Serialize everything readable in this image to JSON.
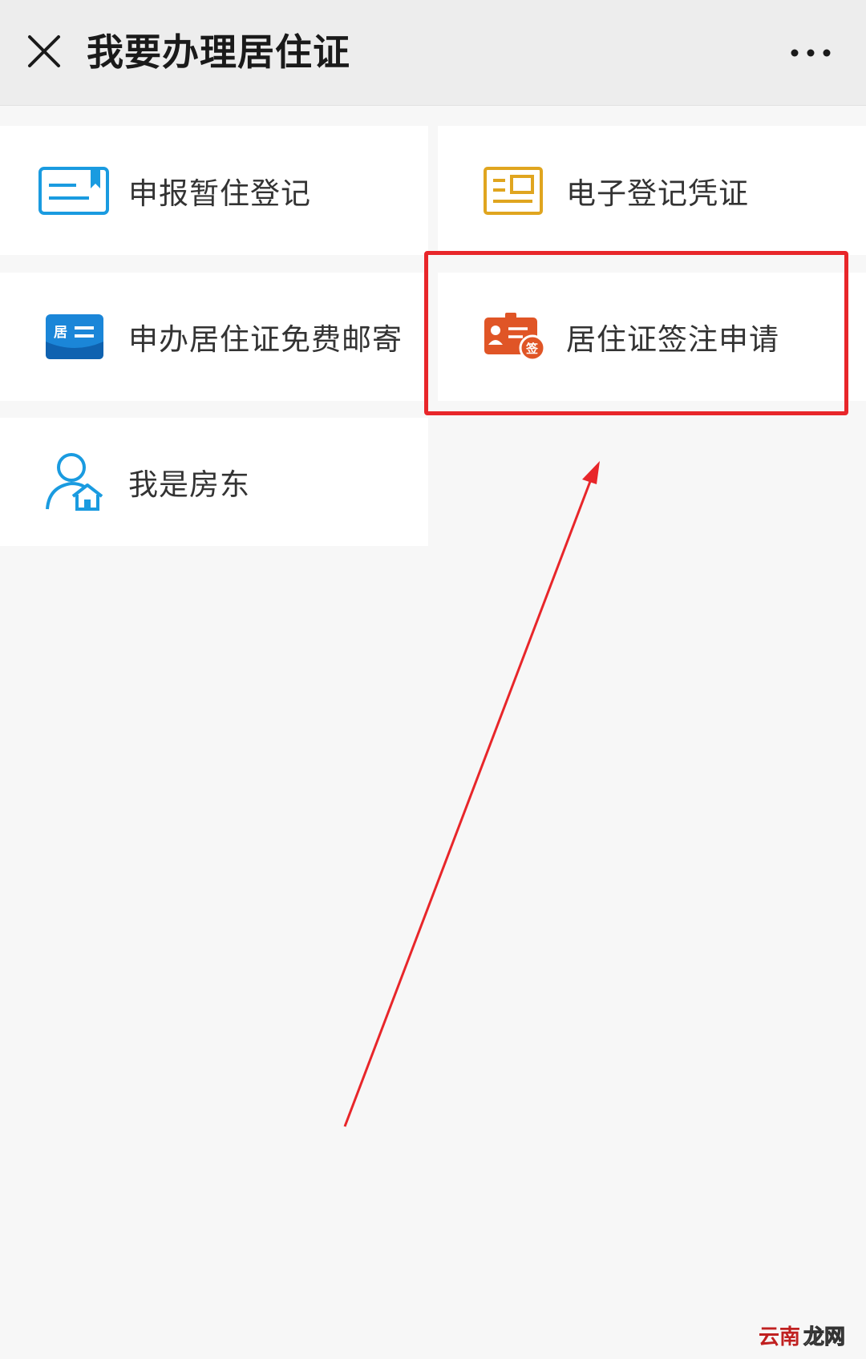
{
  "header": {
    "title": "我要办理居住证",
    "close_icon": "close-icon",
    "more_icon": "more-dots-icon"
  },
  "services": [
    {
      "label": "申报暂住登记",
      "icon": "registration-card-icon",
      "color": "#1a9be0"
    },
    {
      "label": "电子登记凭证",
      "icon": "certificate-icon",
      "color": "#e0a51f"
    },
    {
      "label": "申办居住证免费邮寄",
      "icon": "residence-card-mail-icon",
      "color": "#1b86d8"
    },
    {
      "label": "居住证签注申请",
      "icon": "id-card-sign-icon",
      "color": "#e05526"
    },
    {
      "label": "我是房东",
      "icon": "landlord-icon",
      "color": "#1a9be0"
    }
  ],
  "annotation": {
    "highlight_color": "#e8262a"
  },
  "watermark": {
    "text": "云南龙网"
  }
}
